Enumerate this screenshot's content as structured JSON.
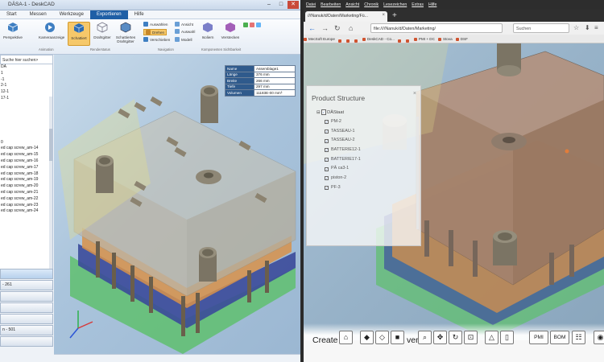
{
  "left_app": {
    "title": "DÄSA-1 - DeskCAD",
    "menu_tabs": [
      "Start",
      "Messen",
      "Werkzeuge",
      "Exportieren",
      "Hilfe"
    ],
    "active_menu_index": 3,
    "ribbon": {
      "buttons": [
        {
          "label": "Perspektive"
        },
        {
          "label": "Kameraanzeige"
        },
        {
          "label": "Schattiert"
        },
        {
          "label": "Drahtgitter"
        },
        {
          "label": "Schattiertes Drahtgitter"
        }
      ],
      "nav_small": [
        "Auswählen",
        "Drehen",
        "Verschieben"
      ],
      "nav_small_right": [
        "Ansicht",
        "Auswahl",
        "Modell"
      ],
      "right_buttons": [
        {
          "label": "Isoliern"
        },
        {
          "label": "Verstecken"
        }
      ],
      "group_labels": [
        "Animation",
        "Renderstatus",
        "Navigation",
        "Komponenten Sichtbarkeit"
      ]
    },
    "tree": {
      "search_placeholder": "Suche hier suchen>",
      "items": [
        "DA",
        "1",
        "-1",
        "2-1",
        "12-1",
        "17-1",
        "",
        "",
        "",
        "",
        "",
        "",
        "0",
        "ed cap screw_am-14",
        "ed cap screw_am-15",
        "ed cap screw_am-16",
        "ed cap screw_am-17",
        "ed cap screw_am-18",
        "ed cap screw_am-19",
        "ed cap screw_am-20",
        "ed cap screw_am-21",
        "ed cap screw_am-22",
        "ed cap screw_am-23",
        "ed cap screw_am-24"
      ]
    },
    "panel_headers": [
      "",
      "- 261",
      "",
      "",
      "",
      "n - 501",
      ""
    ],
    "properties": [
      {
        "key": "Name",
        "value": "Assemblage1"
      },
      {
        "key": "Länge",
        "value": "376 mm"
      },
      {
        "key": "Breite",
        "value": "266 mm"
      },
      {
        "key": "Tiefe",
        "value": "297 mm"
      },
      {
        "key": "Volumen",
        "value": "11183E-00 mm³"
      }
    ]
  },
  "right_app": {
    "menus": [
      "Datei",
      "Bearbeiten",
      "Ansicht",
      "Chronik",
      "Lesezeichen",
      "Extras",
      "Hilfe"
    ],
    "tab_title": "///Nanuk/d/Daten/Marketing/Fü...",
    "url": "file:////Nanuk/d/Daten/Marketing/",
    "search_placeholder": "Suchen",
    "bookmarks": [
      "MecSoft Europe",
      "",
      "",
      "",
      "DeskCAD - Co...",
      "",
      "",
      "PMI + DC",
      "Stova",
      "DSF"
    ],
    "product_structure": {
      "title": "Product Structure",
      "root": "DÄStaat",
      "items": [
        "PM-2",
        "TASSEAU-1",
        "TASSEAU-2",
        "BATTERIE12-1",
        "BATTERIE17-1",
        "PÄ ca3-1",
        "piston-2",
        "PF-3"
      ]
    },
    "footer": {
      "create_text": "Create",
      "create_text_end": "ver",
      "buttons_icons": [
        "home-icon",
        "cube-iso-icon",
        "cube-front-icon",
        "cube-solid-icon",
        "zoom-icon",
        "pan-icon",
        "rotate-icon",
        "zoom-fit-icon",
        "measure-icon",
        "page-icon",
        "table-icon",
        "camera-icon"
      ],
      "pmi_label": "PMI",
      "bom_label": "BOM"
    }
  },
  "colors": {
    "accent_blue": "#1f5fa6",
    "highlight": "#f6c86a",
    "viewport_blue": "#aac4dc"
  }
}
